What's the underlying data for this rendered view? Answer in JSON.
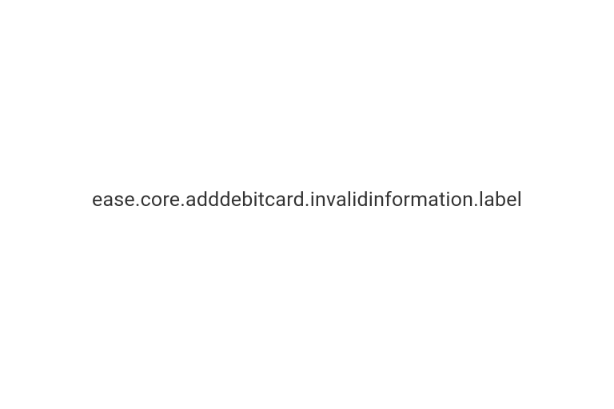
{
  "error": {
    "label_key": "ease.core.adddebitcard.invalidinformation.label"
  }
}
